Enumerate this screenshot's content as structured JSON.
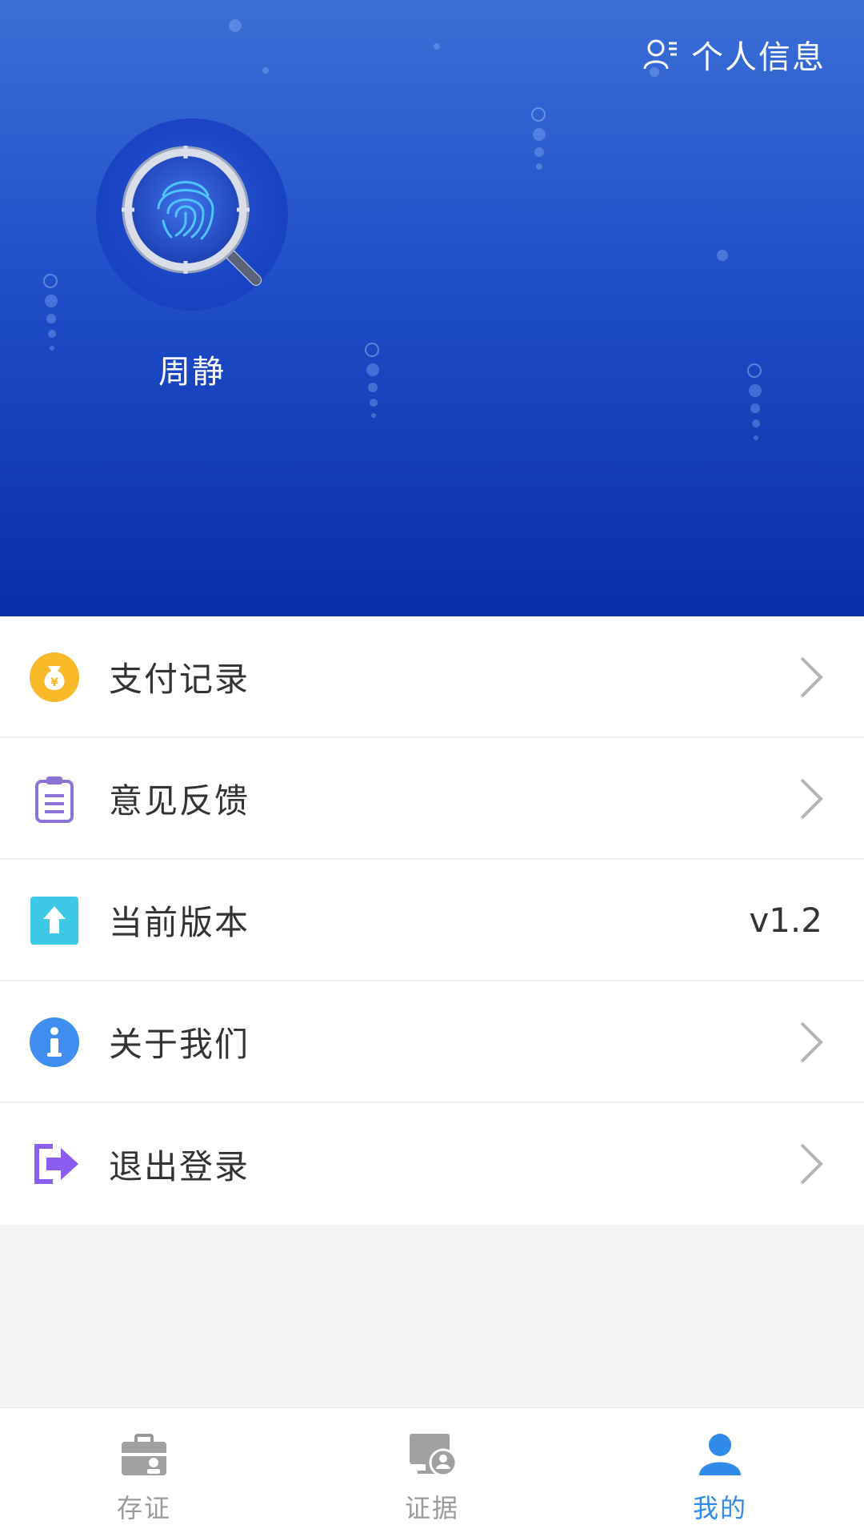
{
  "header": {
    "profile_link_label": "个人信息",
    "username": "周静"
  },
  "menu": {
    "items": [
      {
        "label": "支付记录",
        "icon": "money-bag-icon"
      },
      {
        "label": "意见反馈",
        "icon": "clipboard-icon"
      },
      {
        "label": "当前版本",
        "icon": "upload-arrow-icon",
        "value": "v1.2"
      },
      {
        "label": "关于我们",
        "icon": "info-icon"
      },
      {
        "label": "退出登录",
        "icon": "logout-icon"
      }
    ]
  },
  "bottom_nav": {
    "items": [
      {
        "label": "存证",
        "icon": "briefcase-icon",
        "active": false
      },
      {
        "label": "证据",
        "icon": "monitor-user-icon",
        "active": false
      },
      {
        "label": "我的",
        "icon": "person-icon",
        "active": true
      }
    ]
  },
  "colors": {
    "header_top": "#3b6fd6",
    "header_bottom": "#0a2ea8",
    "active_tab": "#2f8ae8",
    "inactive_tab": "#9a9a9a",
    "money_icon": "#f9b928",
    "clipboard_icon": "#8a72d6",
    "upload_icon": "#3cc8e6",
    "info_icon": "#3f8ef0",
    "logout_icon": "#8a5cf0"
  }
}
